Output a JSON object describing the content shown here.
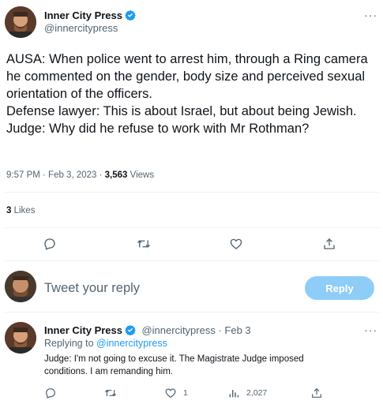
{
  "tweet": {
    "author_name": "Inner City Press",
    "author_handle": "@innercitypress",
    "more_label": "···",
    "text": "AUSA: When police went to arrest him, through a Ring camera he commented on the gender, body size and perceived sexual orientation of the officers.\nDefense lawyer: This is about Israel, but about being Jewish.\nJudge: Why did he refuse to work with Mr Rothman?",
    "time": "9:57 PM · Feb 3, 2023 · ",
    "views_count": "3,563",
    "views_label": " Views",
    "likes_count": "3",
    "likes_label": " Likes",
    "actions": [
      "comment-icon",
      "retweet-icon",
      "heart-icon",
      "share-icon"
    ]
  },
  "composer": {
    "placeholder": "Tweet your reply",
    "button_label": "Reply"
  },
  "reply": {
    "author_name": "Inner City Press",
    "author_handle": "@innercitypress",
    "date": " · Feb 3",
    "more_label": "···",
    "replying_to_prefix": "Replying to ",
    "replying_to_handle": "@innercitypress",
    "text": "Judge: I'm not going to excuse it. The Magistrate Judge imposed conditions. I am remanding him.",
    "like_count": "1",
    "views_count": "2,027"
  },
  "colors": {
    "accent": "#1d9bf0",
    "reply_button": "#8ecdf8",
    "muted": "#536471"
  }
}
